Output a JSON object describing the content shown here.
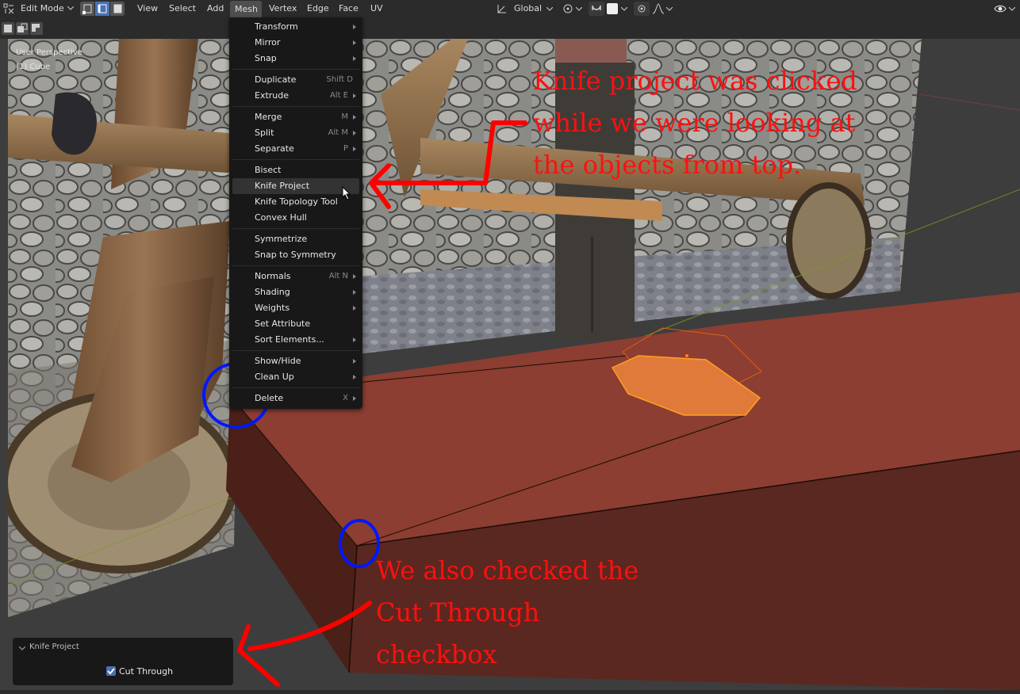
{
  "header": {
    "mode_label": "Edit Mode",
    "menus": [
      "View",
      "Select",
      "Add",
      "Mesh",
      "Vertex",
      "Edge",
      "Face",
      "UV"
    ],
    "transform_orientation": "Global"
  },
  "viewport": {
    "view_name": "User Perspective",
    "object_name": "(1) Cube"
  },
  "mesh_menu": {
    "items": [
      {
        "label": "Transform",
        "shortcut": "",
        "submenu": true
      },
      {
        "label": "Mirror",
        "shortcut": "",
        "submenu": true
      },
      {
        "label": "Snap",
        "shortcut": "",
        "submenu": true
      },
      {
        "label": "Duplicate",
        "shortcut": "Shift D",
        "submenu": false
      },
      {
        "label": "Extrude",
        "shortcut": "Alt E",
        "submenu": true
      },
      {
        "label": "Merge",
        "shortcut": "M",
        "submenu": true
      },
      {
        "label": "Split",
        "shortcut": "Alt M",
        "submenu": true
      },
      {
        "label": "Separate",
        "shortcut": "P",
        "submenu": true
      },
      {
        "label": "Bisect",
        "shortcut": "",
        "submenu": false
      },
      {
        "label": "Knife Project",
        "shortcut": "",
        "submenu": false
      },
      {
        "label": "Knife Topology Tool",
        "shortcut": "",
        "submenu": false
      },
      {
        "label": "Convex Hull",
        "shortcut": "",
        "submenu": false
      },
      {
        "label": "Symmetrize",
        "shortcut": "",
        "submenu": false
      },
      {
        "label": "Snap to Symmetry",
        "shortcut": "",
        "submenu": false
      },
      {
        "label": "Normals",
        "shortcut": "Alt N",
        "submenu": true
      },
      {
        "label": "Shading",
        "shortcut": "",
        "submenu": true
      },
      {
        "label": "Weights",
        "shortcut": "",
        "submenu": true
      },
      {
        "label": "Set Attribute",
        "shortcut": "",
        "submenu": false
      },
      {
        "label": "Sort Elements...",
        "shortcut": "",
        "submenu": true
      },
      {
        "label": "Show/Hide",
        "shortcut": "",
        "submenu": true
      },
      {
        "label": "Clean Up",
        "shortcut": "",
        "submenu": true
      },
      {
        "label": "Delete",
        "shortcut": "X",
        "submenu": true
      }
    ]
  },
  "operator_panel": {
    "title": "Knife Project",
    "cut_through_label": "Cut Through",
    "cut_through_checked": true
  },
  "annotations": {
    "top_lines": [
      "Knife project was clicked",
      "while we were looking at",
      "the objects from top."
    ],
    "bottom_lines": [
      "We also checked the",
      "Cut Through",
      "checkbox"
    ]
  },
  "colors": {
    "accent": "#4772b3",
    "menu_bg": "#181818",
    "annotation": "#ff1010",
    "circle": "#0018ff",
    "mesh_face": "#8b3e31"
  }
}
